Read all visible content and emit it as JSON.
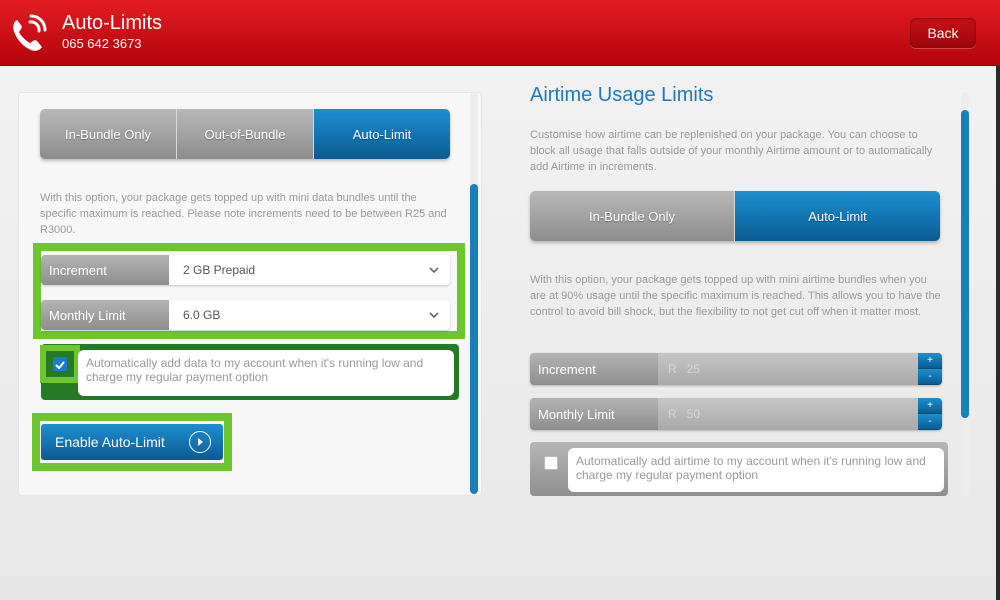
{
  "header": {
    "title": "Auto-Limits",
    "phone": "065 642 3673",
    "back_label": "Back"
  },
  "data_panel": {
    "tabs": [
      {
        "label": "In-Bundle Only",
        "active": false
      },
      {
        "label": "Out-of-Bundle",
        "active": false
      },
      {
        "label": "Auto-Limit",
        "active": true
      }
    ],
    "description": "With this option, your package gets topped up with mini data bundles until the specific maximum is reached. Please note increments need to be between R25 and R3000.",
    "increment_label": "Increment",
    "increment_value": "2 GB Prepaid",
    "monthly_limit_label": "Monthly Limit",
    "monthly_limit_value": "6.0 GB",
    "auto_add_checked": true,
    "auto_add_text": "Automatically add data to my account when it's running low and charge my regular payment option",
    "enable_label": "Enable Auto-Limit"
  },
  "airtime_panel": {
    "title": "Airtime Usage Limits",
    "intro": "Customise how airtime can be replenished on your package. You can choose to block all usage that falls outside of your monthly Airtime amount or to automatically add Airtime in increments.",
    "tabs": [
      {
        "label": "In-Bundle Only",
        "active": false
      },
      {
        "label": "Auto-Limit",
        "active": true
      }
    ],
    "description": "With this option, your package gets topped up with mini airtime bundles when you are at 90% usage until the specific maximum is reached. This allows you to have the control to avoid bill shock, but the flexibility to not get cut off when it matter most.",
    "increment_label": "Increment",
    "currency": "R",
    "increment_value": "25",
    "monthly_limit_label": "Monthly Limit",
    "monthly_limit_value": "50",
    "stepper_plus": "+",
    "stepper_minus": "-",
    "auto_add_checked": false,
    "auto_add_text": "Automatically add airtime to my account when it's running low and charge my regular payment option"
  },
  "colors": {
    "brand_red": "#d0121a",
    "active_blue": "#1a7eb8",
    "highlight_green": "#6ec62e"
  }
}
